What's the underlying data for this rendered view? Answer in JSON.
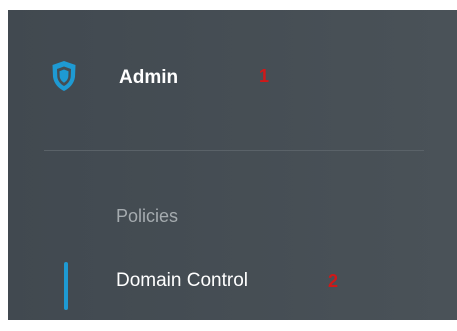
{
  "colors": {
    "accent": "#1e9ad3",
    "sidebar_background": "#454d53",
    "marker_red": "#d01818",
    "muted_text": "#a5abaf"
  },
  "header": {
    "icon": "shield-icon",
    "label": "Admin",
    "marker": "1"
  },
  "menu": {
    "items": [
      {
        "label": "Policies",
        "active": false
      },
      {
        "label": "Domain Control",
        "active": true,
        "marker": "2"
      }
    ]
  }
}
